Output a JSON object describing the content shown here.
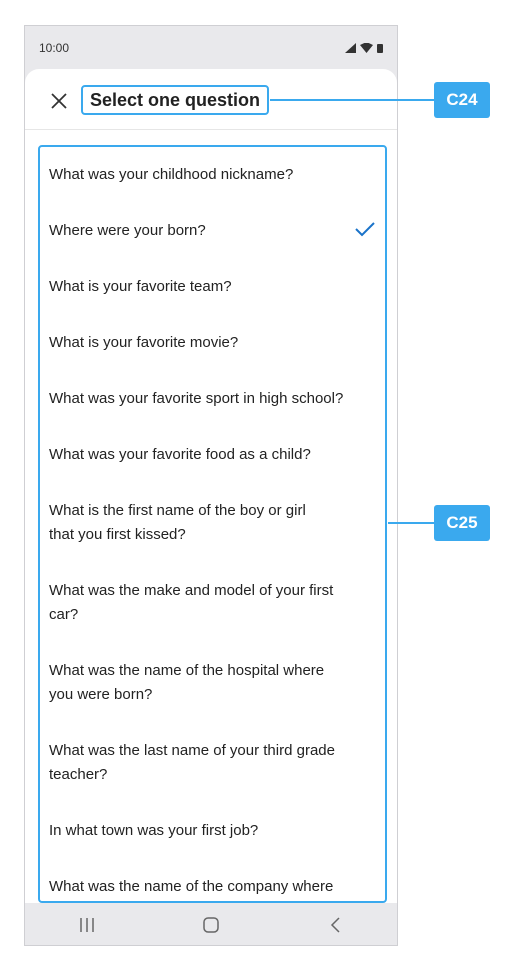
{
  "status_bar": {
    "time": "10:00"
  },
  "header": {
    "title": "Select one question"
  },
  "questions": [
    {
      "line1": "What was your childhood nickname?",
      "line2": ""
    },
    {
      "line1": "Where were your born?",
      "line2": "",
      "selected": true
    },
    {
      "line1": "What is your favorite team?",
      "line2": ""
    },
    {
      "line1": "What is your favorite movie?",
      "line2": ""
    },
    {
      "line1": "What was your favorite sport in high school?",
      "line2": ""
    },
    {
      "line1": "What was your favorite food as a child?",
      "line2": ""
    },
    {
      "line1": "What is the first name of the boy or girl",
      "line2": "that you first kissed?"
    },
    {
      "line1": "What was the make and model of your first",
      "line2": "car?"
    },
    {
      "line1": "What was the name of the hospital where",
      "line2": "you were born?"
    },
    {
      "line1": "What was the last name of your third grade",
      "line2": "teacher?"
    },
    {
      "line1": "In what town was your first job?",
      "line2": ""
    },
    {
      "line1": "What was the name of the company where",
      "line2": ""
    }
  ],
  "callouts": {
    "title_tag": "C24",
    "list_tag": "C25"
  },
  "colors": {
    "accent": "#3aa9ee",
    "check": "#1a73c9"
  },
  "icons": {
    "close": "close-icon",
    "check": "checkmark-icon",
    "recents": "recents-icon",
    "home": "home-icon",
    "back": "back-icon"
  }
}
